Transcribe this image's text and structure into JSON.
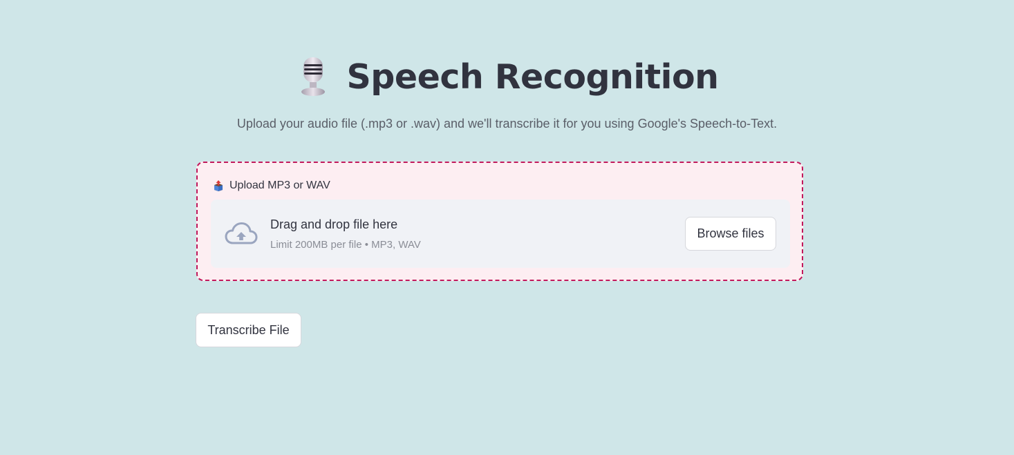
{
  "header": {
    "icon": "studio-microphone-icon",
    "title": "Speech Recognition",
    "subtitle": "Upload your audio file (.mp3 or .wav) and we'll transcribe it for you using Google's Speech-to-Text."
  },
  "uploader": {
    "label_icon": "package-upload-icon",
    "label": "Upload MP3 or WAV",
    "drop_icon": "cloud-upload-icon",
    "drop_text": "Drag and drop file here",
    "limit_text": "Limit 200MB per file • MP3, WAV",
    "browse_label": "Browse files"
  },
  "actions": {
    "transcribe_label": "Transcribe File"
  },
  "colors": {
    "background": "#cfe6e8",
    "uploader_border": "#c2185b",
    "uploader_background": "#fdeef2",
    "dropzone_background": "#f0f2f6",
    "text_primary": "#31333f",
    "text_secondary": "#8a8d96"
  }
}
